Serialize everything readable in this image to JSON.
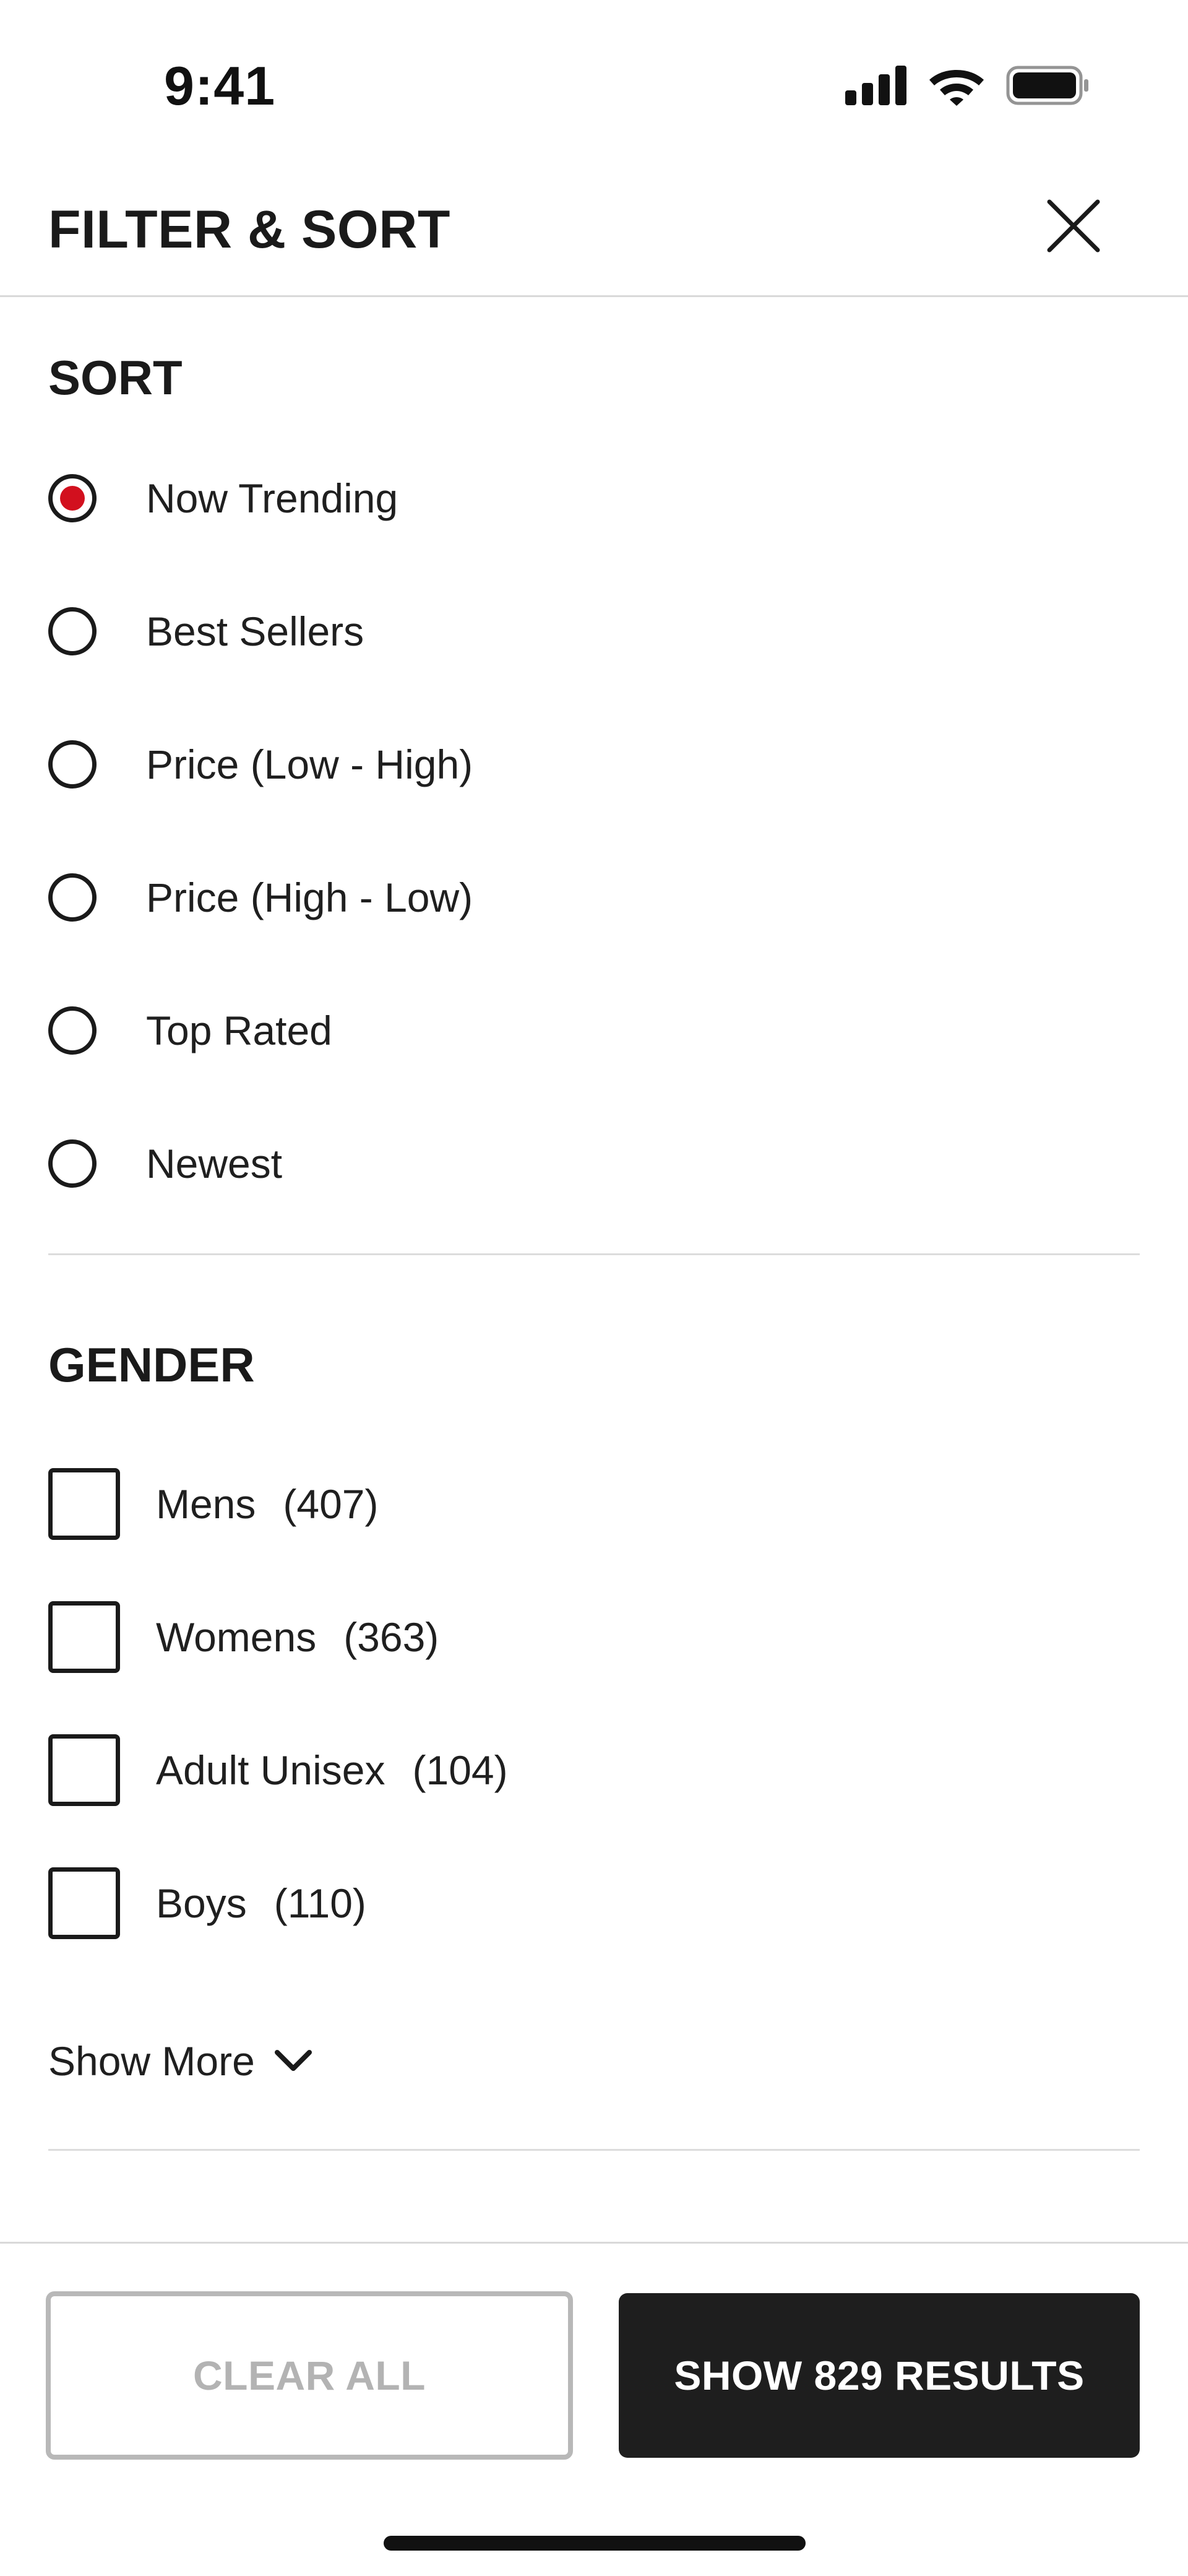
{
  "status_bar": {
    "time": "9:41",
    "icons": [
      "cellular-signal-icon",
      "wifi-icon",
      "battery-icon"
    ]
  },
  "header": {
    "title": "FILTER & SORT",
    "close_icon": "close-icon"
  },
  "sort": {
    "title": "SORT",
    "options": [
      {
        "label": "Now Trending",
        "selected": true
      },
      {
        "label": "Best Sellers",
        "selected": false
      },
      {
        "label": "Price (Low - High)",
        "selected": false
      },
      {
        "label": "Price (High - Low)",
        "selected": false
      },
      {
        "label": "Top Rated",
        "selected": false
      },
      {
        "label": "Newest",
        "selected": false
      }
    ]
  },
  "gender": {
    "title": "GENDER",
    "options": [
      {
        "label": "Mens",
        "count": "(407)",
        "checked": false
      },
      {
        "label": "Womens",
        "count": "(363)",
        "checked": false
      },
      {
        "label": "Adult Unisex",
        "count": "(104)",
        "checked": false
      },
      {
        "label": "Boys",
        "count": "(110)",
        "checked": false
      }
    ],
    "show_more_label": "Show More",
    "show_more_icon": "chevron-down-icon"
  },
  "footer": {
    "clear_all_label": "CLEAR ALL",
    "show_results_label": "SHOW 829 RESULTS"
  },
  "colors": {
    "accent_red": "#d2101e",
    "primary_dark": "#1e1e1e",
    "disabled_gray": "#b3b3b3",
    "divider": "#dcdcdc"
  }
}
